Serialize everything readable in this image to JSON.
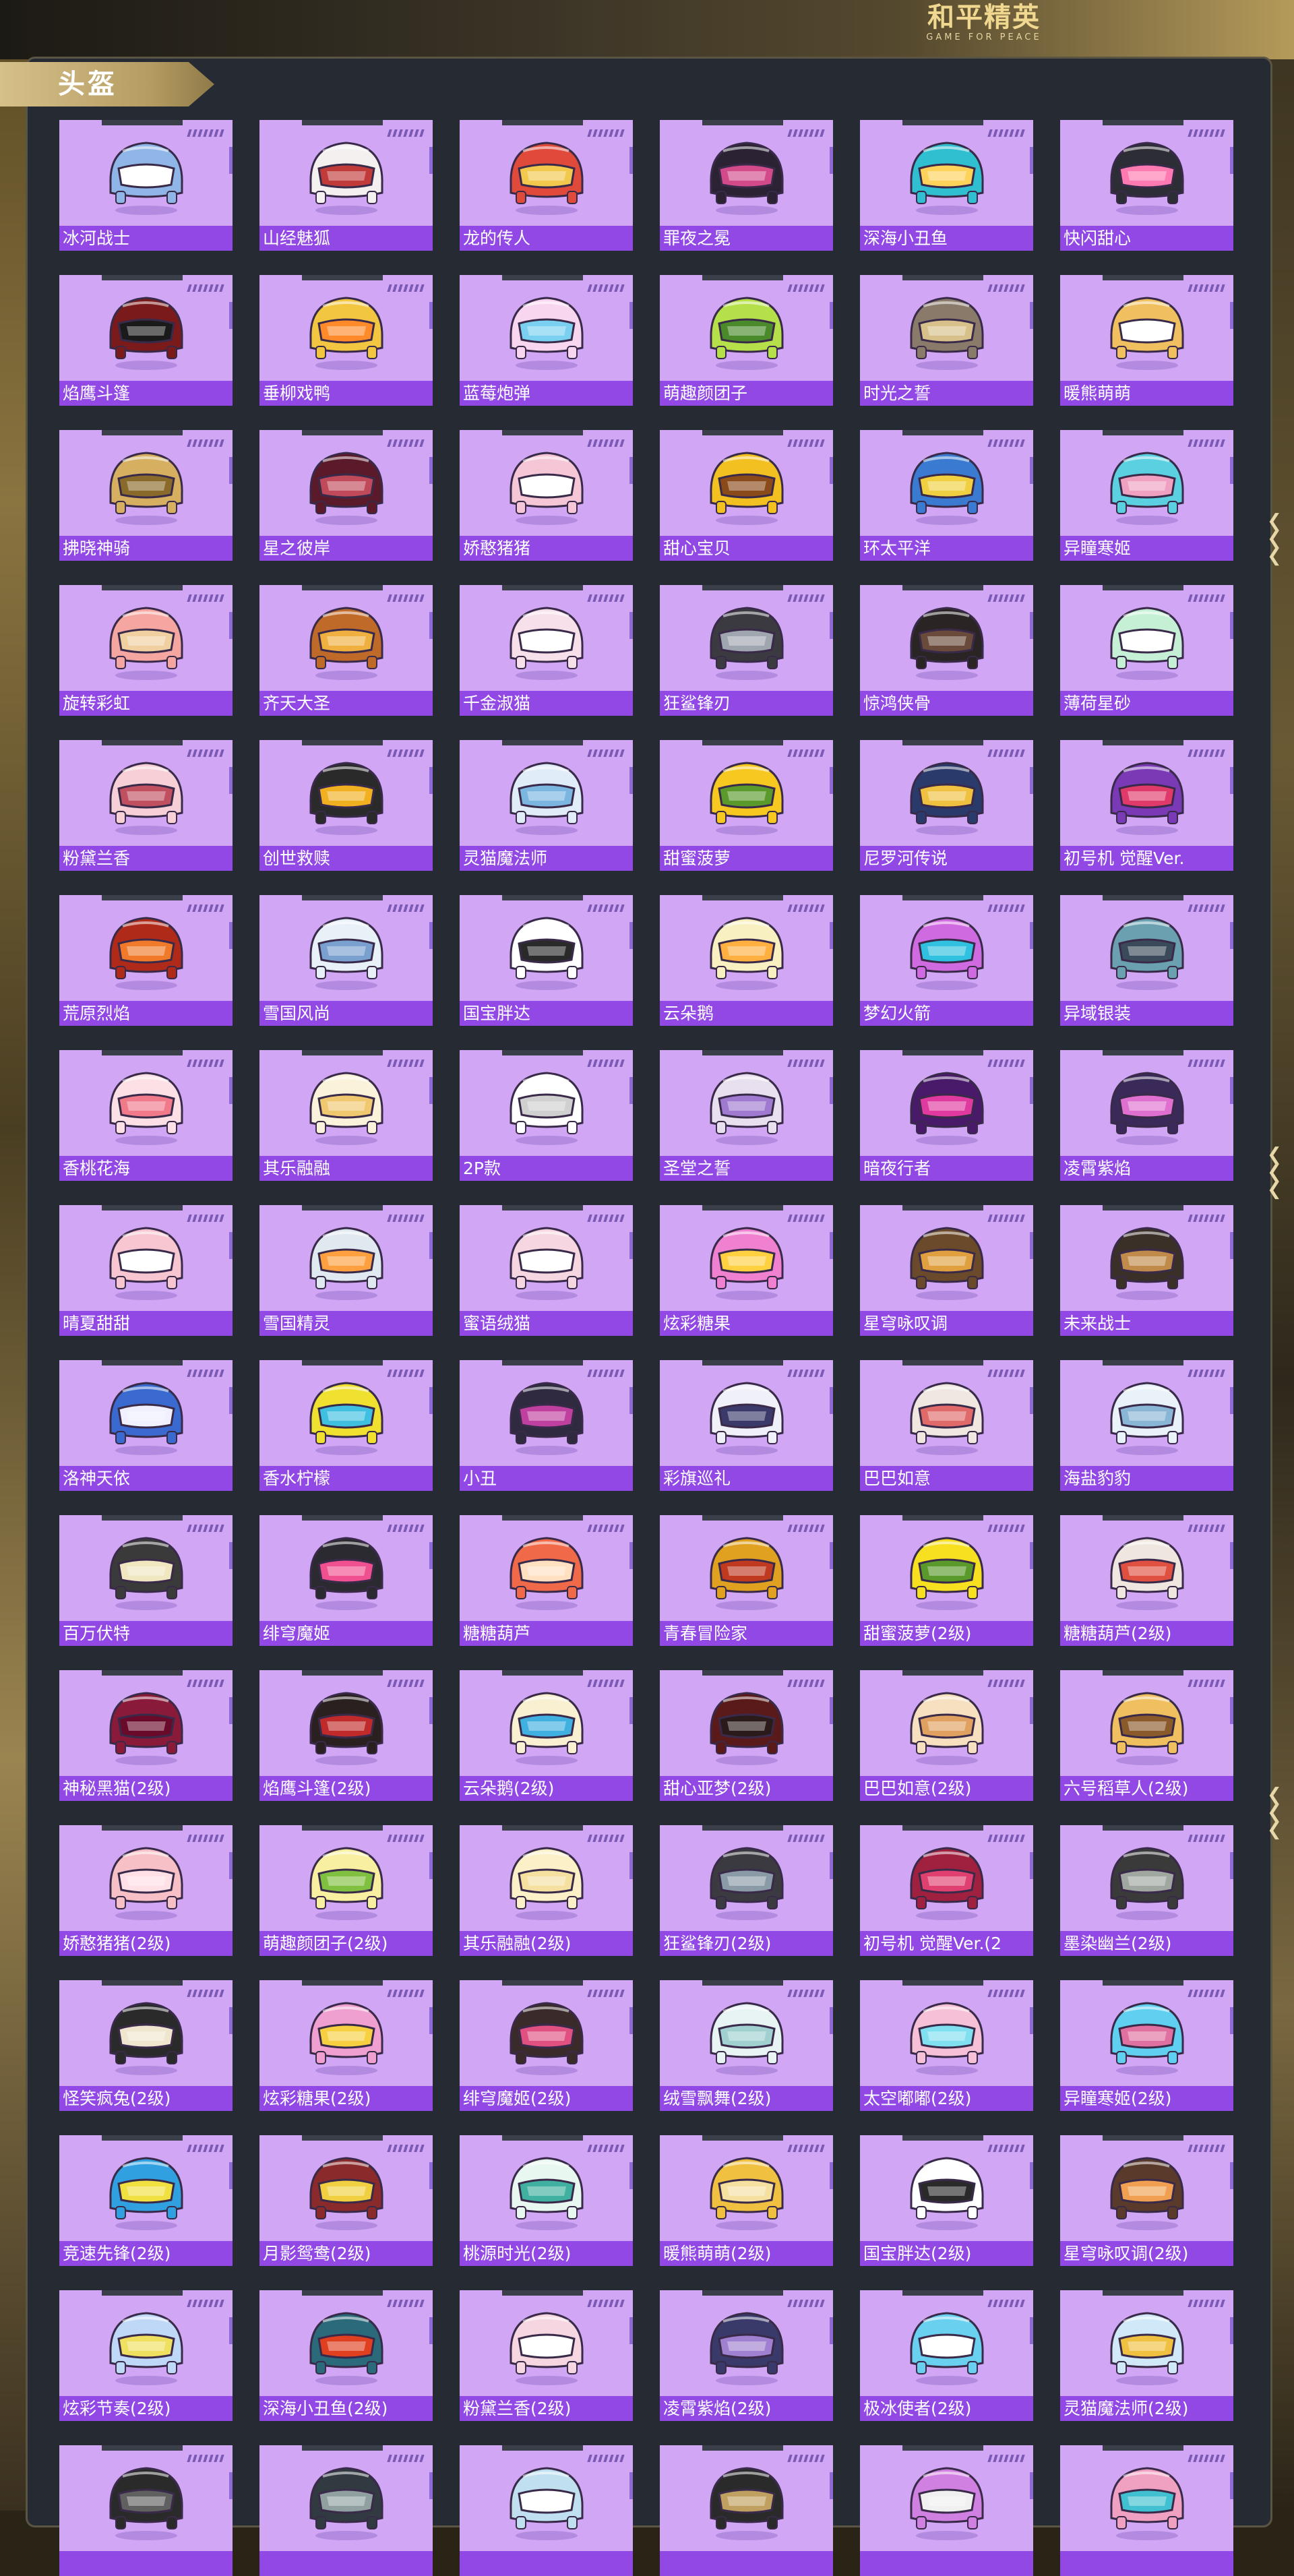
{
  "header": {
    "logo_main": "和平精英",
    "logo_sub": "GAME FOR PEACE"
  },
  "section": {
    "title": "头盔"
  },
  "items": [
    "冰河战士",
    "山经魅狐",
    "龙的传人",
    "罪夜之冕",
    "深海小丑鱼",
    "快闪甜心",
    "焰鹰斗篷",
    "垂柳戏鸭",
    "蓝莓炮弹",
    "萌趣颜团子",
    "时光之誓",
    "暖熊萌萌",
    "拂晓神骑",
    "星之彼岸",
    "娇憨猪猪",
    "甜心宝贝",
    "环太平洋",
    "异瞳寒姬",
    "旋转彩虹",
    "齐天大圣",
    "千金淑猫",
    "狂鲨锋刃",
    "惊鸿侠骨",
    "薄荷星砂",
    "粉黛兰香",
    "创世救赎",
    "灵猫魔法师",
    "甜蜜菠萝",
    "尼罗河传说",
    "初号机 觉醒Ver.",
    "荒原烈焰",
    "雪国风尚",
    "国宝胖达",
    "云朵鹅",
    "梦幻火箭",
    "异域银装",
    "香桃花海",
    "其乐融融",
    "2P款",
    "圣堂之誓",
    "暗夜行者",
    "凌霄紫焰",
    "晴夏甜甜",
    "雪国精灵",
    "蜜语绒猫",
    "炫彩糖果",
    "星穹咏叹调",
    "未来战士",
    "洛神天依",
    "香水柠檬",
    "小丑",
    "彩旗巡礼",
    "巴巴如意",
    "海盐豹豹",
    "百万伏特",
    "绯穹魔姬",
    "糖糖葫芦",
    "青春冒险家",
    "甜蜜菠萝(2级)",
    "糖糖葫芦(2级)",
    "神秘黑猫(2级)",
    "焰鹰斗篷(2级)",
    "云朵鹅(2级)",
    "甜心亚梦(2级)",
    "巴巴如意(2级)",
    "六号稻草人(2级)",
    "娇憨猪猪(2级)",
    "萌趣颜团子(2级)",
    "其乐融融(2级)",
    "狂鲨锋刃(2级)",
    "初号机 觉醒Ver.(2",
    "墨染幽兰(2级)",
    "怪笑疯兔(2级)",
    "炫彩糖果(2级)",
    "绯穹魔姬(2级)",
    "绒雪飘舞(2级)",
    "太空嘟嘟(2级)",
    "异瞳寒姬(2级)",
    "竞速先锋(2级)",
    "月影鸳鸯(2级)",
    "桃源时光(2级)",
    "暖熊萌萌(2级)",
    "国宝胖达(2级)",
    "星穹咏叹调(2级)",
    "炫彩节奏(2级)",
    "深海小丑鱼(2级)",
    "粉黛兰香(2级)",
    "凌霄紫焰(2级)",
    "极冰使者(2级)",
    "灵猫魔法师(2级)",
    "",
    "",
    "",
    "",
    "",
    ""
  ],
  "colors": {
    "card_bg": "#d0a6f5",
    "label_bar": "#9248e4",
    "panel_bg": "#262a33",
    "tab_gold": "#d6c08a"
  },
  "helmet_palette": [
    [
      "#8fb6e6",
      "#ffffff"
    ],
    [
      "#f4f0f0",
      "#c23b3b"
    ],
    [
      "#e04a3a",
      "#f2c94c"
    ],
    [
      "#2b2333",
      "#d24a8a"
    ],
    [
      "#2fbfd0",
      "#ffd25a"
    ],
    [
      "#2d2d35",
      "#ff7ab0"
    ],
    [
      "#7a1a1a",
      "#1a1a1a"
    ],
    [
      "#f2c640",
      "#ff8a2a"
    ],
    [
      "#f8d6f0",
      "#7ad0f0"
    ],
    [
      "#b6e04a",
      "#4a8a2a"
    ],
    [
      "#8a7a6a",
      "#d8c08a"
    ],
    [
      "#f0c060",
      "#ffffff"
    ],
    [
      "#d6b060",
      "#8a6a2a"
    ],
    [
      "#5a1a2a",
      "#c04a5a"
    ],
    [
      "#f5c6d6",
      "#ffffff"
    ],
    [
      "#f2c020",
      "#8a4a1a"
    ],
    [
      "#3a7ad0",
      "#f0d040"
    ],
    [
      "#5ad0e0",
      "#f0a0c0"
    ],
    [
      "#f5a6a0",
      "#f0d0a0"
    ],
    [
      "#c06a2a",
      "#f0b040"
    ],
    [
      "#f8e0ea",
      "#ffffff"
    ],
    [
      "#3a3a40",
      "#a0a6b0"
    ],
    [
      "#2a2424",
      "#6a4a3a"
    ],
    [
      "#c6f0d6",
      "#ffffff"
    ],
    [
      "#f6d0d6",
      "#c05060"
    ],
    [
      "#2a2a2a",
      "#f0b020"
    ],
    [
      "#e0ecf8",
      "#7ab6e0"
    ],
    [
      "#f6c820",
      "#5a9a2a"
    ],
    [
      "#2a3a6a",
      "#f0c040"
    ],
    [
      "#7a3ab6",
      "#e03a6a"
    ],
    [
      "#b02a1a",
      "#f07a2a"
    ],
    [
      "#e8f0f8",
      "#7aa0d0"
    ],
    [
      "#ffffff",
      "#2a2a2a"
    ],
    [
      "#f8f0c0",
      "#ffb040"
    ],
    [
      "#d06ae0",
      "#30c0e0"
    ],
    [
      "#6aa0b0",
      "#3a4a5a"
    ],
    [
      "#fde0e6",
      "#f07a8a"
    ],
    [
      "#fbf2dc",
      "#f0c870"
    ],
    [
      "#ffffff",
      "#d0d0d0"
    ],
    [
      "#e8e0ee",
      "#a07ad0"
    ],
    [
      "#4a1a6a",
      "#e03aa0"
    ],
    [
      "#3a2a5a",
      "#e070d0"
    ],
    [
      "#f8c6d0",
      "#ffffff"
    ],
    [
      "#e0e8f0",
      "#ffa040"
    ],
    [
      "#f6d6e0",
      "#ffffff"
    ],
    [
      "#f080d0",
      "#ffd040"
    ],
    [
      "#6a4a2a",
      "#e0a040"
    ],
    [
      "#3a3028",
      "#c08a4a"
    ],
    [
      "#3a6ad0",
      "#f0f0ff"
    ],
    [
      "#f0e030",
      "#40c0e0"
    ],
    [
      "#302a40",
      "#c040a0"
    ],
    [
      "#f0f0f8",
      "#3a3a6a"
    ],
    [
      "#f0e8e0",
      "#e06a6a"
    ],
    [
      "#e8f2f8",
      "#8ab6d6"
    ],
    [
      "#3a3a3a",
      "#f0e6c0"
    ],
    [
      "#2a2a30",
      "#f05090"
    ],
    [
      "#f06a4a",
      "#ffe0c0"
    ],
    [
      "#e0a020",
      "#c03a20"
    ],
    [
      "#f6e020",
      "#5a9a2a"
    ],
    [
      "#f0e6e0",
      "#e05040"
    ],
    [
      "#8a1a3a",
      "#6a0a2a"
    ],
    [
      "#2a2020",
      "#c02a2a"
    ],
    [
      "#f8f0d0",
      "#40b0e0"
    ],
    [
      "#5a1a1a",
      "#2a1a1a"
    ],
    [
      "#f6e0c0",
      "#e0a060"
    ],
    [
      "#f0c060",
      "#8a5a2a"
    ],
    [
      "#f6c0c6",
      "#ffe0e6"
    ],
    [
      "#f8f0a0",
      "#80c040"
    ],
    [
      "#fbf0c8",
      "#f6e0a0"
    ],
    [
      "#3a3a40",
      "#8a9aa6"
    ],
    [
      "#a02040",
      "#e04070"
    ],
    [
      "#3a3a3a",
      "#a0a6a0"
    ],
    [
      "#2a2a2a",
      "#f0e6d0"
    ],
    [
      "#f0a0d0",
      "#f6d040"
    ],
    [
      "#3a2a2a",
      "#e05080"
    ],
    [
      "#e8f4f4",
      "#a0d0d0"
    ],
    [
      "#f6c0d6",
      "#80e0f0"
    ],
    [
      "#60d0f0",
      "#e070a0"
    ],
    [
      "#30a0e0",
      "#f0e040"
    ],
    [
      "#8a2a2a",
      "#f0d040"
    ],
    [
      "#e8f8f0",
      "#40b0a0"
    ],
    [
      "#f0c040",
      "#f6e0a0"
    ],
    [
      "#ffffff",
      "#2a2a2a"
    ],
    [
      "#5a3a2a",
      "#f0a050"
    ],
    [
      "#c0d8f8",
      "#f0e060"
    ],
    [
      "#2a6a7a",
      "#e04020"
    ],
    [
      "#f6d6e0",
      "#ffffff"
    ],
    [
      "#3a3a6a",
      "#a080d0"
    ],
    [
      "#6ad0f0",
      "#ffffff"
    ],
    [
      "#d0e8f8",
      "#f0c040"
    ],
    [
      "#2a2a2a",
      "#606060"
    ],
    [
      "#303a40",
      "#90a0a0"
    ],
    [
      "#c0e0f0",
      "#ffffff"
    ],
    [
      "#2a2a2a",
      "#c0a060"
    ],
    [
      "#d080e0",
      "#f0f0f0"
    ],
    [
      "#f0a0c0",
      "#40c0d0"
    ]
  ]
}
